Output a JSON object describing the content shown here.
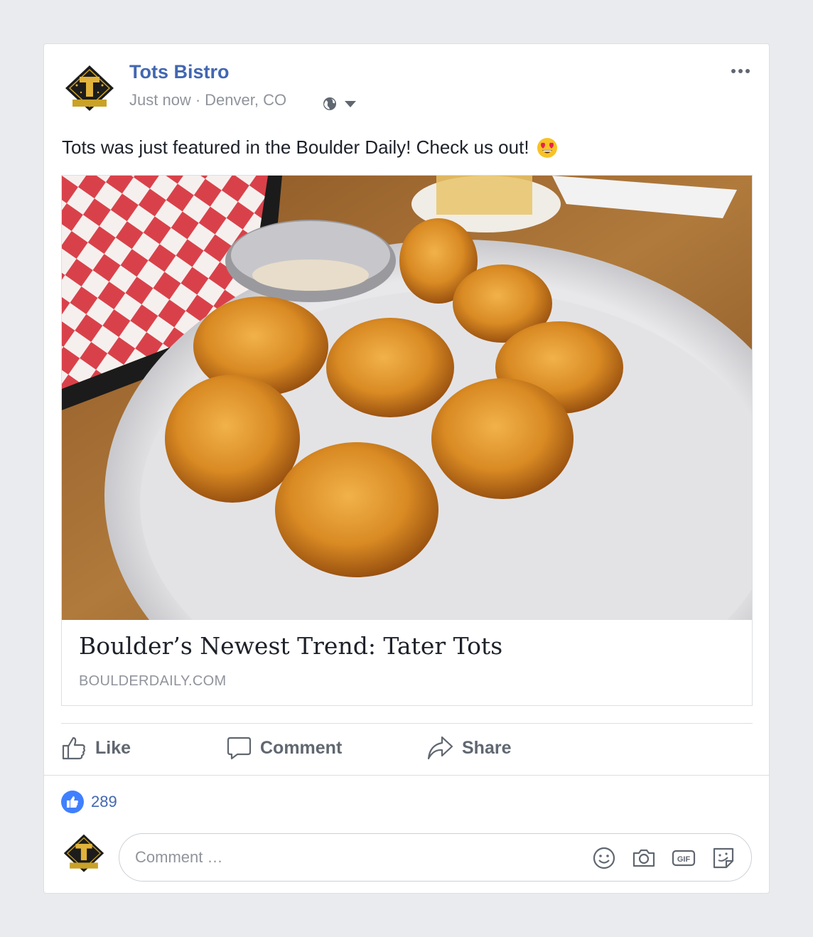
{
  "post": {
    "page_name": "Tots Bistro",
    "timestamp": "Just now",
    "separator": "·",
    "location": "Denver, CO",
    "privacy_icon": "globe-icon",
    "text": "Tots was just featured in the Boulder Daily! Check us out!",
    "emoji": "heart-eyes-emoji"
  },
  "link_preview": {
    "image": "plate of tater tots with dipping sauce",
    "title": "Boulder’s Newest Trend: Tater Tots",
    "domain": "BOULDERDAILY.COM"
  },
  "actions": {
    "like_label": "Like",
    "comment_label": "Comment",
    "share_label": "Share"
  },
  "reactions": {
    "count": "289"
  },
  "composer": {
    "placeholder": "Comment …",
    "icons": [
      "smiley-icon",
      "camera-icon",
      "gif-icon",
      "sticker-icon"
    ]
  },
  "colors": {
    "brand_blue": "#4267b2",
    "like_badge": "#4080ff",
    "background": "#e9ebee",
    "muted_text": "#90949c"
  }
}
